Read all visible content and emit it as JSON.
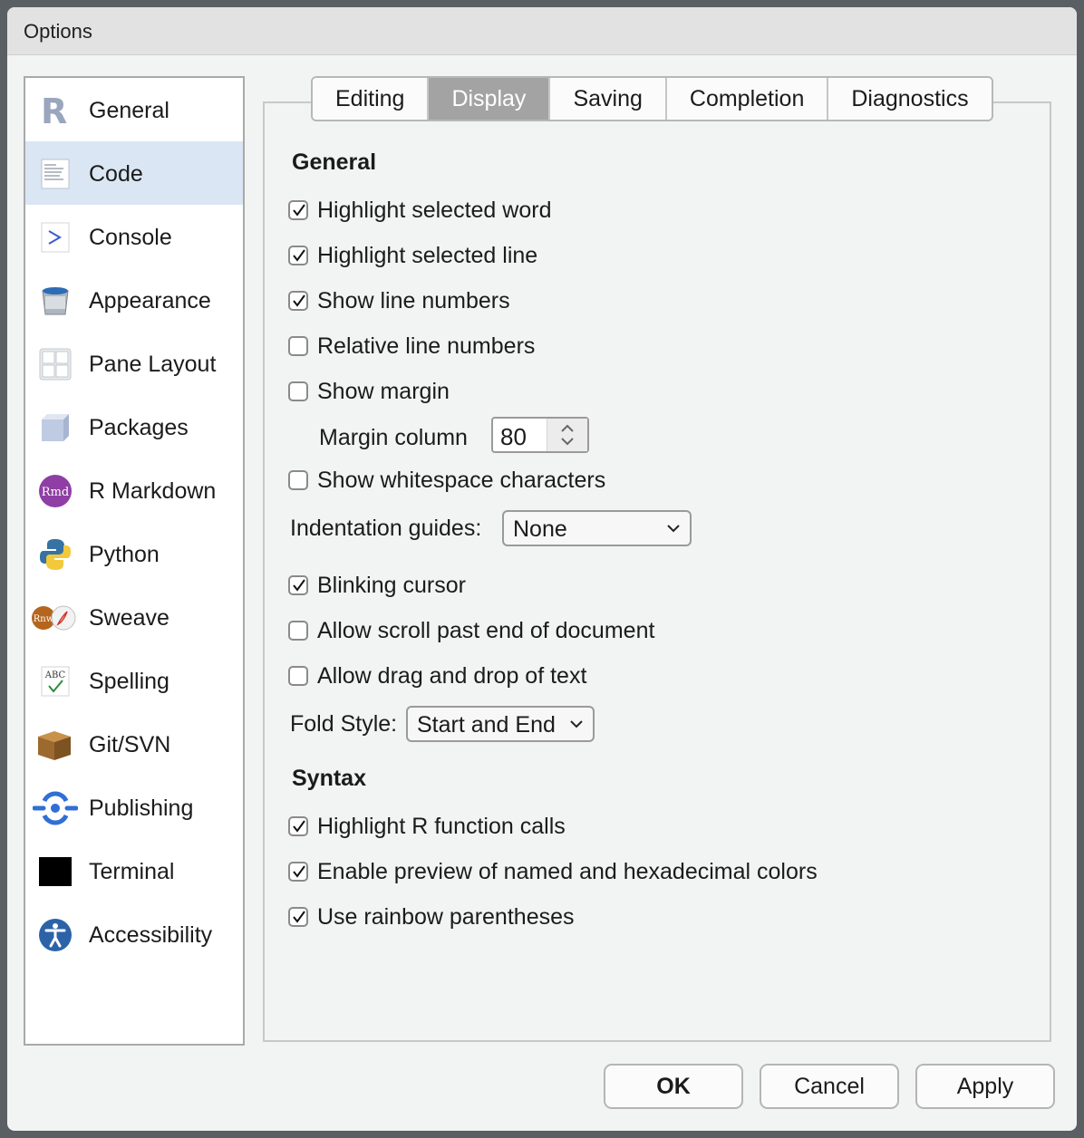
{
  "window": {
    "title": "Options"
  },
  "sidebar": {
    "items": [
      {
        "label": "General",
        "icon": "r-logo-icon",
        "selected": false
      },
      {
        "label": "Code",
        "icon": "code-file-icon",
        "selected": true
      },
      {
        "label": "Console",
        "icon": "console-prompt-icon",
        "selected": false
      },
      {
        "label": "Appearance",
        "icon": "paint-bucket-icon",
        "selected": false
      },
      {
        "label": "Pane Layout",
        "icon": "pane-grid-icon",
        "selected": false
      },
      {
        "label": "Packages",
        "icon": "package-cube-icon",
        "selected": false
      },
      {
        "label": "R Markdown",
        "icon": "rmd-icon",
        "selected": false
      },
      {
        "label": "Python",
        "icon": "python-icon",
        "selected": false
      },
      {
        "label": "Sweave",
        "icon": "sweave-icon",
        "selected": false
      },
      {
        "label": "Spelling",
        "icon": "spelling-abc-icon",
        "selected": false
      },
      {
        "label": "Git/SVN",
        "icon": "git-box-icon",
        "selected": false
      },
      {
        "label": "Publishing",
        "icon": "publishing-icon",
        "selected": false
      },
      {
        "label": "Terminal",
        "icon": "terminal-icon",
        "selected": false
      },
      {
        "label": "Accessibility",
        "icon": "accessibility-icon",
        "selected": false
      }
    ]
  },
  "tabs": [
    {
      "label": "Editing",
      "active": false
    },
    {
      "label": "Display",
      "active": true
    },
    {
      "label": "Saving",
      "active": false
    },
    {
      "label": "Completion",
      "active": false
    },
    {
      "label": "Diagnostics",
      "active": false
    }
  ],
  "general": {
    "heading": "General",
    "highlight_selected_word": {
      "label": "Highlight selected word",
      "checked": true
    },
    "highlight_selected_line": {
      "label": "Highlight selected line",
      "checked": true
    },
    "show_line_numbers": {
      "label": "Show line numbers",
      "checked": true
    },
    "relative_line_numbers": {
      "label": "Relative line numbers",
      "checked": false
    },
    "show_margin": {
      "label": "Show margin",
      "checked": false
    },
    "margin_column": {
      "label": "Margin column",
      "value": "80"
    },
    "show_whitespace": {
      "label": "Show whitespace characters",
      "checked": false
    },
    "indentation_guides": {
      "label": "Indentation guides:",
      "value": "None"
    },
    "blinking_cursor": {
      "label": "Blinking cursor",
      "checked": true
    },
    "scroll_past_end": {
      "label": "Allow scroll past end of document",
      "checked": false
    },
    "drag_drop_text": {
      "label": "Allow drag and drop of text",
      "checked": false
    },
    "fold_style": {
      "label": "Fold Style:",
      "value": "Start and End"
    }
  },
  "syntax": {
    "heading": "Syntax",
    "highlight_function_calls": {
      "label": "Highlight R function calls",
      "checked": true
    },
    "color_preview": {
      "label": "Enable preview of named and hexadecimal colors",
      "checked": true
    },
    "rainbow_parens": {
      "label": "Use rainbow parentheses",
      "checked": true
    }
  },
  "buttons": {
    "ok": "OK",
    "cancel": "Cancel",
    "apply": "Apply"
  },
  "colors": {
    "selected_sidebar": "#dae6f3",
    "active_tab": "#a3a3a3",
    "window_bg": "#f2f3f3"
  }
}
